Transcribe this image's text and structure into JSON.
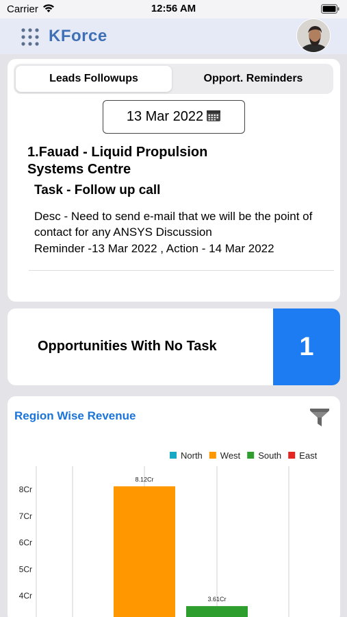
{
  "status_bar": {
    "carrier": "Carrier",
    "time": "12:56 AM"
  },
  "nav": {
    "title": "KForce"
  },
  "leads": {
    "tabs": [
      {
        "label": "Leads Followups",
        "active": true
      },
      {
        "label": "Opport. Reminders",
        "active": false
      }
    ],
    "date": "13 Mar 2022",
    "item": {
      "title": "1.Fauad - Liquid Propulsion Systems Centre",
      "task": "Task - Follow up call",
      "desc": "Desc - Need to send e-mail that we will be the point of contact for any ANSYS Discussion",
      "reminder": "Reminder -13 Mar 2022 , Action - 14 Mar 2022"
    }
  },
  "opportunities": {
    "label": "Opportunities With No Task",
    "count": "1"
  },
  "chart": {
    "title": "Region Wise Revenue",
    "filter_icon": "filter-icon"
  },
  "chart_data": {
    "type": "bar",
    "title": "Region Wise Revenue",
    "series": [
      {
        "name": "North",
        "color": "#17a8c4",
        "value": null,
        "label": ""
      },
      {
        "name": "West",
        "color": "#ff9800",
        "value": 8.12,
        "label": "8.12Cr"
      },
      {
        "name": "South",
        "color": "#2e9e2e",
        "value": 3.61,
        "label": "3.61Cr"
      },
      {
        "name": "East",
        "color": "#e52424",
        "value": null,
        "label": ""
      }
    ],
    "y_ticks": [
      "4Cr",
      "5Cr",
      "6Cr",
      "7Cr",
      "8Cr"
    ],
    "y_tick_values": [
      4,
      5,
      6,
      7,
      8
    ],
    "legend_position": "top-right",
    "grid": "vertical"
  },
  "colors": {
    "accent": "#1d7cf2",
    "brand": "#3f6fb5",
    "link": "#1a73d9"
  }
}
